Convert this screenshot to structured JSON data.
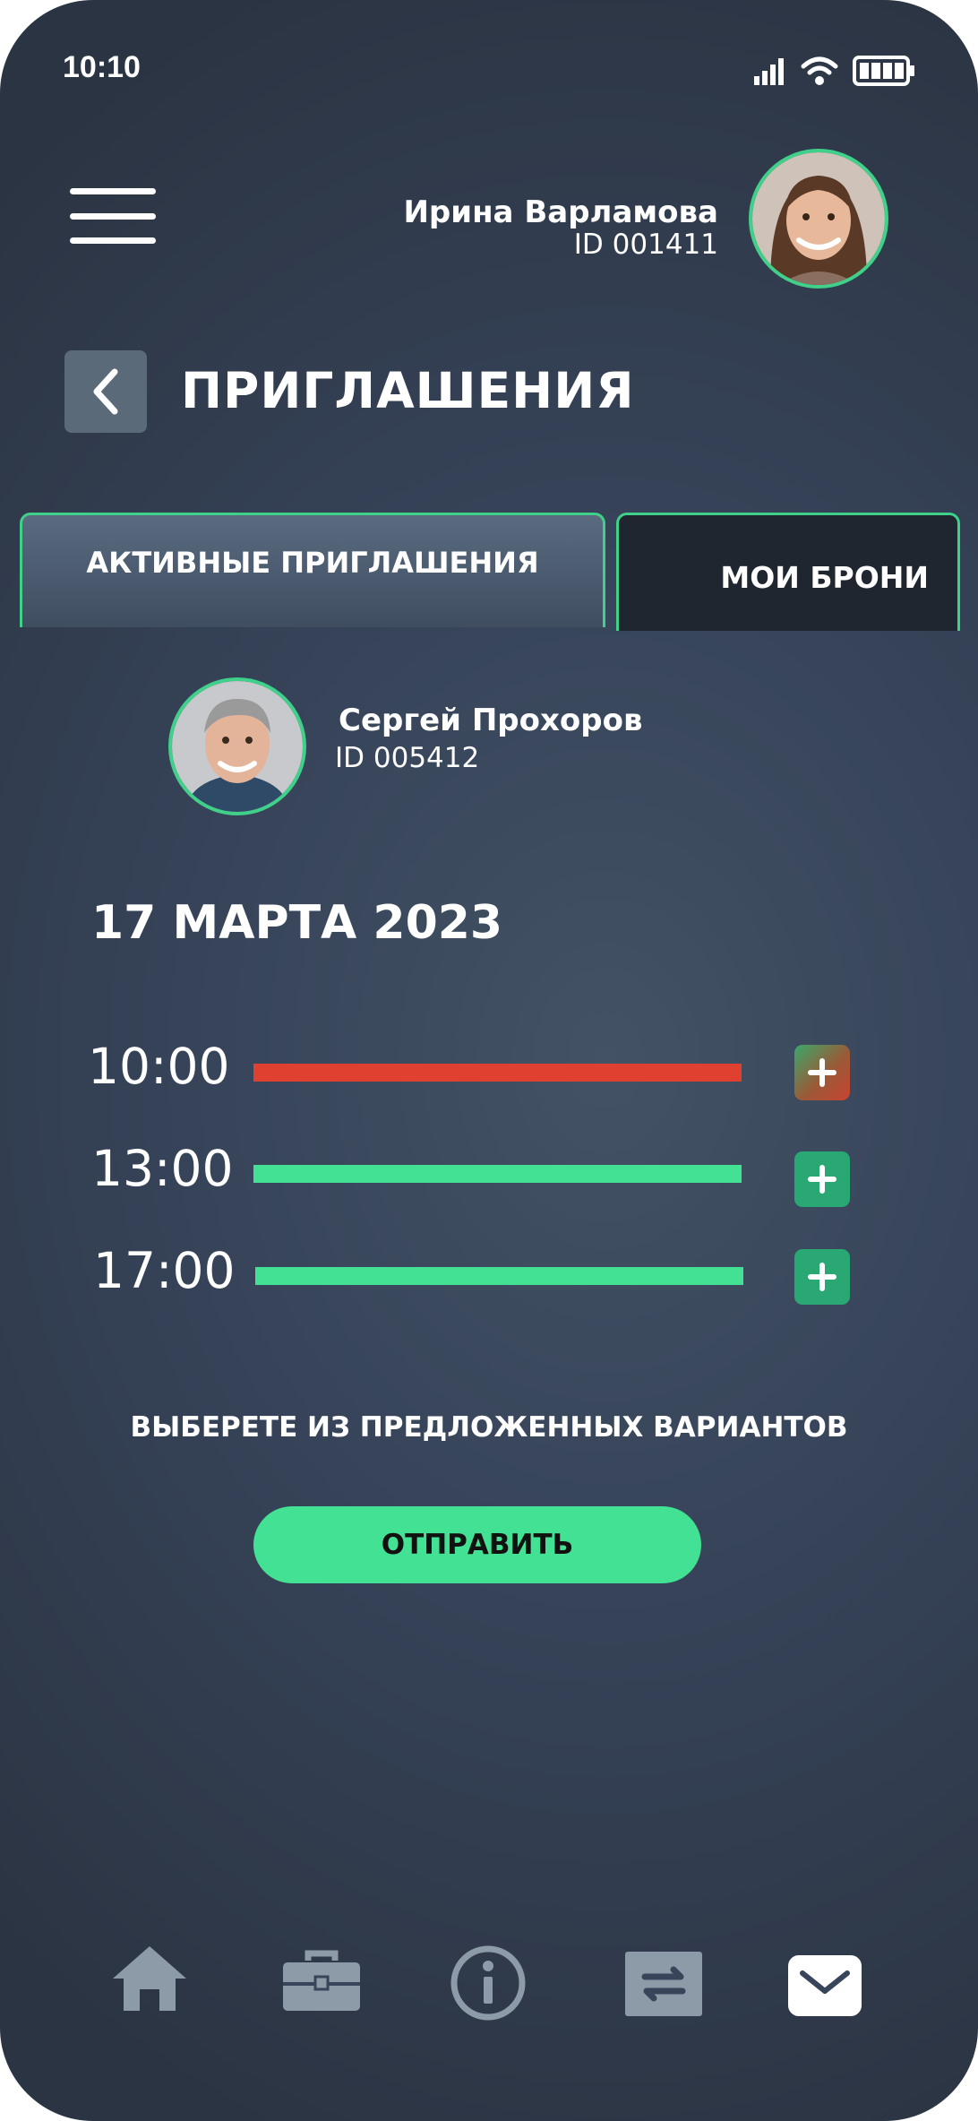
{
  "status_bar": {
    "time": "10:10"
  },
  "user": {
    "name": "Ирина Варламова",
    "id": "ID 001411"
  },
  "page": {
    "title": "ПРИГЛАШЕНИЯ"
  },
  "tabs": [
    {
      "label": "АКТИВНЫЕ ПРИГЛАШЕНИЯ",
      "active": true
    },
    {
      "label": "МОИ БРОНИ",
      "active": false
    }
  ],
  "invitation": {
    "host_name": "Сергей Прохоров",
    "host_id": "ID 005412",
    "date": "17 МАРТА 2023",
    "slots": [
      {
        "time": "10:00",
        "status": "busy"
      },
      {
        "time": "13:00",
        "status": "free"
      },
      {
        "time": "17:00",
        "status": "free"
      }
    ]
  },
  "hint": "ВЫБЕРЕТЕ ИЗ ПРЕДЛОЖЕННЫХ ВАРИАНТОВ",
  "send_label": "ОТПРАВИТЬ",
  "bottom_nav": [
    "home-icon",
    "briefcase-icon",
    "info-icon",
    "exchange-icon",
    "mail-icon"
  ],
  "colors": {
    "accent": "#43e193",
    "busy": "#e0402f",
    "background": "#37445a"
  }
}
